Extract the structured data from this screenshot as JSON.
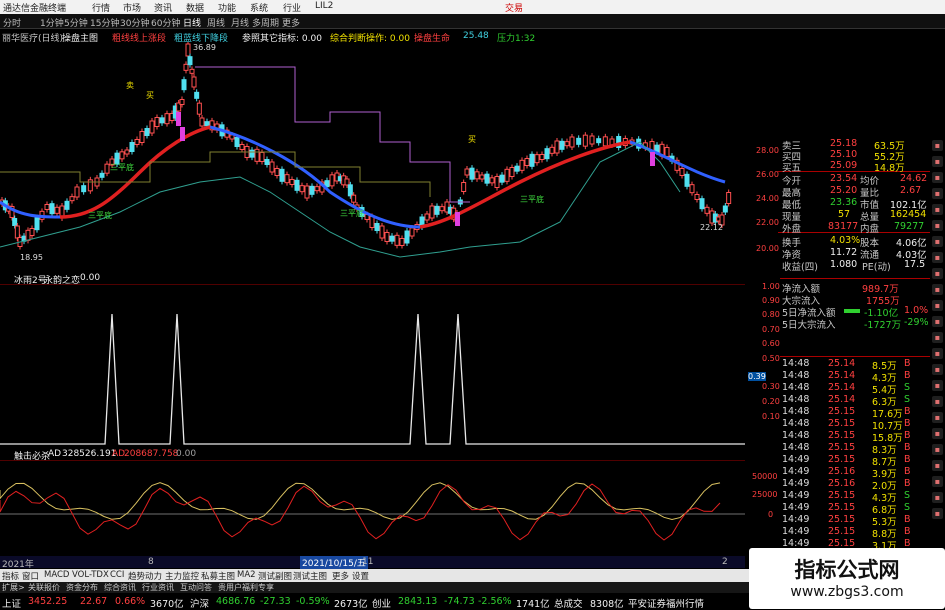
{
  "window": {
    "title": "通达信金融终端",
    "menu": [
      "行情",
      "市场",
      "资讯",
      "数据",
      "功能",
      "系统",
      "行业",
      "LIL2",
      "交易"
    ]
  },
  "toolbar": {
    "items": [
      "分时",
      "1分钟",
      "5分钟",
      "15分钟",
      "30分钟",
      "60分钟",
      "日线",
      "周线",
      "月线",
      "多周期",
      "更多"
    ]
  },
  "chart_header": {
    "stock": "丽华医疗(日线)",
    "indicator": "操盘主图",
    "labels": [
      "粗线线上涨段",
      "粗蓝线下降段",
      "参照其它指标: 0.00",
      "综合判断操作: 0.00",
      "操盘生命",
      "压力1:32"
    ],
    "values": [
      "25.48"
    ]
  },
  "main_chart": {
    "annotations": [
      "36.89",
      "18.95",
      "22.12"
    ],
    "signals": [
      "卖",
      "三平底",
      "三平底",
      "三平底",
      "三平底",
      "买",
      "买"
    ]
  },
  "panel2": {
    "title": "冰雨2号",
    "subtitle": "永韵之恋",
    "value": "0.00",
    "yaxis": [
      "1.00",
      "0.90",
      "0.80",
      "0.70",
      "0.60",
      "0.50",
      "0.39",
      "0.30",
      "0.20",
      "0.10"
    ]
  },
  "panel3": {
    "title": "触击必杀",
    "ad_label": "AD",
    "ad_value": "328526.191",
    "ad2_label": "AD",
    "ad2_value": "208687.758",
    "ad3_value": "0.00",
    "yaxis": [
      "50000",
      "25000",
      "0"
    ]
  },
  "yaxis_main": [
    "28.00",
    "26.00",
    "24.00",
    "22.00",
    "20.00"
  ],
  "quote": {
    "sell": [
      {
        "label": "卖三",
        "price": "25.18",
        "vol": "63.5万"
      },
      {
        "label": "买四",
        "price": "25.10",
        "vol": "55.2万"
      },
      {
        "label": "买五",
        "price": "25.09",
        "vol": "14.8万"
      }
    ],
    "rows": [
      {
        "l1": "今开",
        "v1": "23.54",
        "l2": "均价",
        "v2": "24.62"
      },
      {
        "l1": "最高",
        "v1": "25.20",
        "l2": "量比",
        "v2": "2.67"
      },
      {
        "l1": "最低",
        "v1": "23.36",
        "l2": "市值",
        "v2": "102.1亿"
      },
      {
        "l1": "现量",
        "v1": "57",
        "l2": "总量",
        "v2": "162454"
      },
      {
        "l1": "外盘",
        "v1": "83177",
        "l2": "内盘",
        "v2": "79277"
      },
      {
        "l1": "换手",
        "v1": "4.03%",
        "l2": "股本",
        "v2": "4.06亿"
      },
      {
        "l1": "净资",
        "v1": "11.72",
        "l2": "流通",
        "v2": "4.03亿"
      },
      {
        "l1": "收益(四)",
        "v1": "1.080",
        "l2": "PE(动)",
        "v2": "17.5"
      }
    ]
  },
  "flow": [
    {
      "label": "净流入额",
      "value": "989.7万"
    },
    {
      "label": "大宗流入",
      "value": "1755万"
    },
    {
      "label": "5日净流入额",
      "value": "-1.10亿"
    },
    {
      "label": "5日大宗流入",
      "value": "-1727万"
    }
  ],
  "flow_side": [
    "1.0%",
    "-29%"
  ],
  "ticks": [
    {
      "t": "14:48",
      "p": "25.14",
      "v": "8.5万",
      "d": "B"
    },
    {
      "t": "14:48",
      "p": "25.14",
      "v": "4.3万",
      "d": "B"
    },
    {
      "t": "14:48",
      "p": "25.14",
      "v": "5.4万",
      "d": "S"
    },
    {
      "t": "14:48",
      "p": "25.14",
      "v": "6.3万",
      "d": "S"
    },
    {
      "t": "14:48",
      "p": "25.15",
      "v": "17.6万",
      "d": "B"
    },
    {
      "t": "14:48",
      "p": "25.15",
      "v": "10.7万",
      "d": "B"
    },
    {
      "t": "14:48",
      "p": "25.15",
      "v": "15.8万",
      "d": "B"
    },
    {
      "t": "14:48",
      "p": "25.15",
      "v": "8.3万",
      "d": "B"
    },
    {
      "t": "14:49",
      "p": "25.15",
      "v": "8.7万",
      "d": "B"
    },
    {
      "t": "14:49",
      "p": "25.16",
      "v": "3.9万",
      "d": "B"
    },
    {
      "t": "14:49",
      "p": "25.16",
      "v": "2.0万",
      "d": "B"
    },
    {
      "t": "14:49",
      "p": "25.15",
      "v": "4.3万",
      "d": "S"
    },
    {
      "t": "14:49",
      "p": "25.15",
      "v": "6.8万",
      "d": "S"
    },
    {
      "t": "14:49",
      "p": "25.15",
      "v": "5.3万",
      "d": "B"
    },
    {
      "t": "14:49",
      "p": "25.15",
      "v": "8.8万",
      "d": "B"
    },
    {
      "t": "14:49",
      "p": "25.15",
      "v": "3.1万",
      "d": "B"
    }
  ],
  "date_axis": {
    "labels": [
      "2021年",
      "8",
      "2021/10/15/五",
      "11",
      "2"
    ]
  },
  "bottom_tabs": [
    "指标",
    "窗口",
    "MACD",
    "VOL-TDX",
    "CCI",
    "趋势动力",
    "主力监控",
    "私募主图",
    "MA2",
    "测试副图",
    "测试主图",
    "更多",
    "设置"
  ],
  "bottom_tabs2": [
    "扩展>",
    "关联报价",
    "资金分布",
    "综合资讯",
    "行业资讯",
    "互动问答",
    "贵用户福利专享"
  ],
  "statusbar": {
    "items": [
      {
        "label": "上证",
        "v": "3452.25",
        "c": "22.67",
        "p": "0.66%",
        "amt": "3670亿"
      },
      {
        "label": "沪深",
        "v": "4686.76",
        "c": "-27.33",
        "p": "-0.59%",
        "amt": "2673亿"
      },
      {
        "label": "创业",
        "v": "2843.13",
        "c": "-74.73",
        "p": "-2.56%",
        "amt": "1741亿"
      }
    ],
    "total_label": "总成交",
    "total": "8308亿",
    "broker": "平安证券福州行情"
  },
  "watermark": {
    "title": "指标公式网",
    "url": "www.zbgs3.com"
  }
}
